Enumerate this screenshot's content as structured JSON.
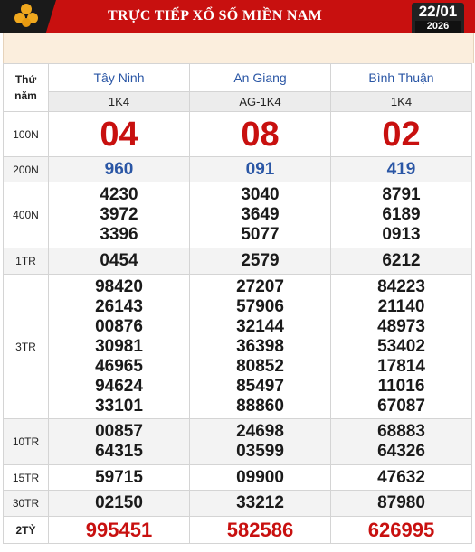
{
  "header": {
    "title": "TRỰC TIẾP XỔ SỐ MIỀN NAM",
    "date_day": "22/01",
    "date_year": "2026"
  },
  "table": {
    "label_col_line1": "Thứ",
    "label_col_line2": "năm",
    "provinces": [
      {
        "name": "Tây Ninh",
        "code": "1K4"
      },
      {
        "name": "An Giang",
        "code": "AG-1K4"
      },
      {
        "name": "Bình Thuận",
        "code": "1K4"
      }
    ],
    "prizes": [
      {
        "label": "100N",
        "values": [
          [
            "04"
          ],
          [
            "08"
          ],
          [
            "02"
          ]
        ]
      },
      {
        "label": "200N",
        "values": [
          [
            "960"
          ],
          [
            "091"
          ],
          [
            "419"
          ]
        ]
      },
      {
        "label": "400N",
        "values": [
          [
            "4230",
            "3972",
            "3396"
          ],
          [
            "3040",
            "3649",
            "5077"
          ],
          [
            "8791",
            "6189",
            "0913"
          ]
        ]
      },
      {
        "label": "1TR",
        "values": [
          [
            "0454"
          ],
          [
            "2579"
          ],
          [
            "6212"
          ]
        ]
      },
      {
        "label": "3TR",
        "values": [
          [
            "98420",
            "26143",
            "00876",
            "30981",
            "46965",
            "94624",
            "33101"
          ],
          [
            "27207",
            "57906",
            "32144",
            "36398",
            "80852",
            "85497",
            "88860"
          ],
          [
            "84223",
            "21140",
            "48973",
            "53402",
            "17814",
            "11016",
            "67087"
          ]
        ]
      },
      {
        "label": "10TR",
        "values": [
          [
            "00857",
            "64315"
          ],
          [
            "24698",
            "03599"
          ],
          [
            "68883",
            "64326"
          ]
        ]
      },
      {
        "label": "15TR",
        "values": [
          [
            "59715"
          ],
          [
            "09900"
          ],
          [
            "47632"
          ]
        ]
      },
      {
        "label": "30TR",
        "values": [
          [
            "02150"
          ],
          [
            "33212"
          ],
          [
            "87980"
          ]
        ]
      },
      {
        "label": "2TỶ",
        "values": [
          [
            "995451"
          ],
          [
            "582586"
          ],
          [
            "626995"
          ]
        ]
      }
    ]
  }
}
